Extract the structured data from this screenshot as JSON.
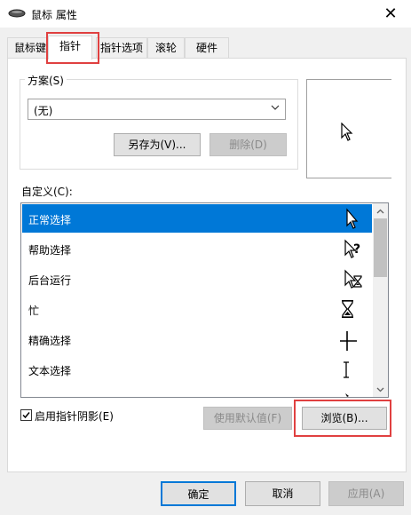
{
  "window": {
    "title": "鼠标 属性",
    "close": "✕"
  },
  "tabs": [
    {
      "label": "鼠标键"
    },
    {
      "label": "指针"
    },
    {
      "label": "指针选项"
    },
    {
      "label": "滚轮"
    },
    {
      "label": "硬件"
    }
  ],
  "scheme": {
    "group_label": "方案(S)",
    "selected": "(无)",
    "save_as": "另存为(V)...",
    "delete": "删除(D)"
  },
  "custom": {
    "label": "自定义(C):",
    "items": [
      {
        "label": "正常选择",
        "icon": "arrow-cursor-icon"
      },
      {
        "label": "帮助选择",
        "icon": "help-cursor-icon"
      },
      {
        "label": "后台运行",
        "icon": "working-in-background-cursor-icon"
      },
      {
        "label": "忙",
        "icon": "busy-hourglass-cursor-icon"
      },
      {
        "label": "精确选择",
        "icon": "precision-crosshair-cursor-icon"
      },
      {
        "label": "文本选择",
        "icon": "text-ibeam-cursor-icon"
      }
    ]
  },
  "shadow": {
    "label": "启用指针阴影(E)",
    "checked": true
  },
  "buttons": {
    "use_default": "使用默认值(F)",
    "browse": "浏览(B)...",
    "ok": "确定",
    "cancel": "取消",
    "apply": "应用(A)"
  },
  "colors": {
    "accent": "#0078d7",
    "highlight": "#e04040"
  }
}
